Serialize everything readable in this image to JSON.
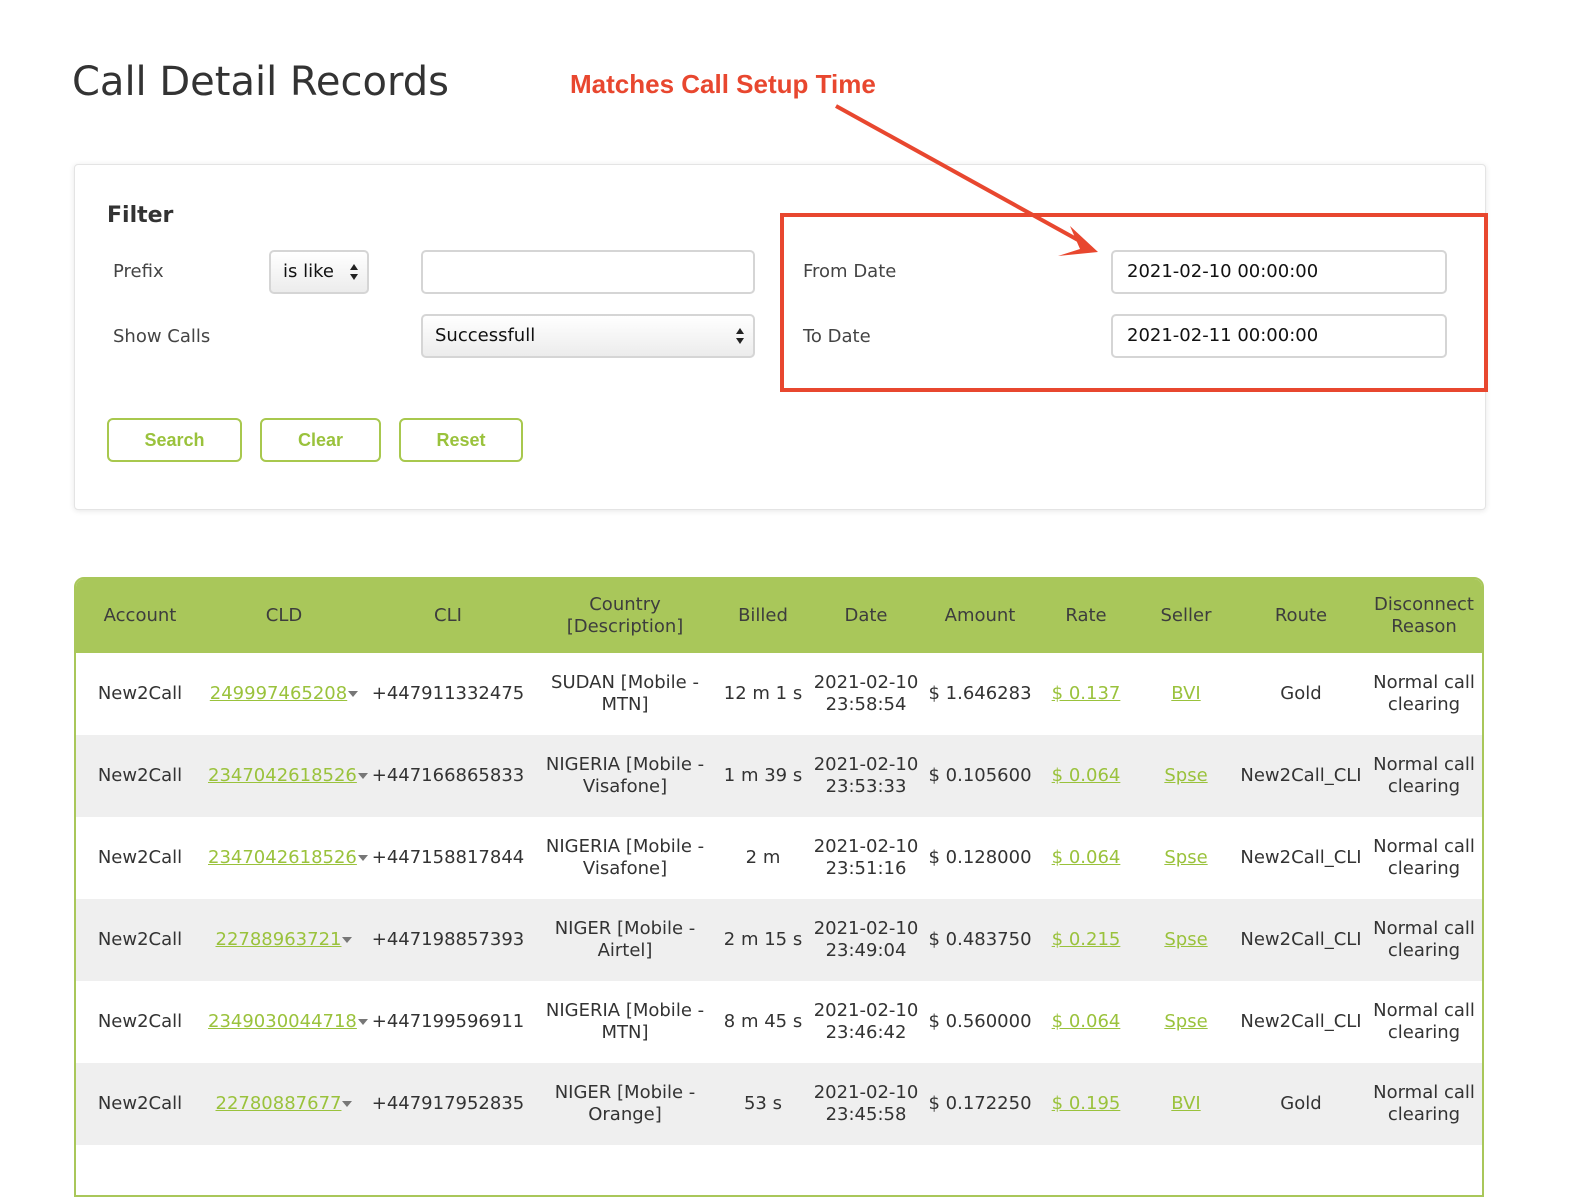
{
  "page": {
    "title": "Call Detail Records"
  },
  "annotation": {
    "text": "Matches Call Setup Time",
    "color": "#e8472f"
  },
  "filter": {
    "title": "Filter",
    "prefix_label": "Prefix",
    "prefix_operator": "is like",
    "prefix_value": "",
    "show_calls_label": "Show Calls",
    "show_calls_value": "Successfull",
    "from_date_label": "From Date",
    "from_date_value": "2021-02-10 00:00:00",
    "to_date_label": "To Date",
    "to_date_value": "2021-02-11 00:00:00",
    "search_label": "Search",
    "clear_label": "Clear",
    "reset_label": "Reset"
  },
  "colors": {
    "accent": "#9ac23c",
    "header_bg": "#a9c75a",
    "annotation": "#e8472f"
  },
  "table": {
    "columns": [
      "Account",
      "CLD",
      "CLI",
      "Country [Description]",
      "Billed",
      "Date",
      "Amount",
      "Rate",
      "Seller",
      "Route",
      "Disconnect Reason"
    ],
    "rows": [
      {
        "account": "New2Call",
        "cld": "249997465208",
        "cli": "+447911332475",
        "country": "SUDAN [Mobile - MTN]",
        "billed": "12 m 1 s",
        "date": "2021-02-10 23:58:54",
        "amount": "$ 1.646283",
        "rate": "$ 0.137",
        "seller": "BVI",
        "route": "Gold",
        "reason": "Normal call clearing"
      },
      {
        "account": "New2Call",
        "cld": "2347042618526",
        "cli": "+447166865833",
        "country": "NIGERIA [Mobile - Visafone]",
        "billed": "1 m 39 s",
        "date": "2021-02-10 23:53:33",
        "amount": "$ 0.105600",
        "rate": "$ 0.064",
        "seller": "Spse",
        "route": "New2Call_CLI",
        "reason": "Normal call clearing"
      },
      {
        "account": "New2Call",
        "cld": "2347042618526",
        "cli": "+447158817844",
        "country": "NIGERIA [Mobile - Visafone]",
        "billed": "2 m",
        "date": "2021-02-10 23:51:16",
        "amount": "$ 0.128000",
        "rate": "$ 0.064",
        "seller": "Spse",
        "route": "New2Call_CLI",
        "reason": "Normal call clearing"
      },
      {
        "account": "New2Call",
        "cld": "22788963721",
        "cli": "+447198857393",
        "country": "NIGER [Mobile - Airtel]",
        "billed": "2 m 15 s",
        "date": "2021-02-10 23:49:04",
        "amount": "$ 0.483750",
        "rate": "$ 0.215",
        "seller": "Spse",
        "route": "New2Call_CLI",
        "reason": "Normal call clearing"
      },
      {
        "account": "New2Call",
        "cld": "2349030044718",
        "cli": "+447199596911",
        "country": "NIGERIA [Mobile - MTN]",
        "billed": "8 m 45 s",
        "date": "2021-02-10 23:46:42",
        "amount": "$ 0.560000",
        "rate": "$ 0.064",
        "seller": "Spse",
        "route": "New2Call_CLI",
        "reason": "Normal call clearing"
      },
      {
        "account": "New2Call",
        "cld": "22780887677",
        "cli": "+447917952835",
        "country": "NIGER [Mobile - Orange]",
        "billed": "53 s",
        "date": "2021-02-10 23:45:58",
        "amount": "$ 0.172250",
        "rate": "$ 0.195",
        "seller": "BVI",
        "route": "Gold",
        "reason": "Normal call clearing"
      }
    ]
  }
}
